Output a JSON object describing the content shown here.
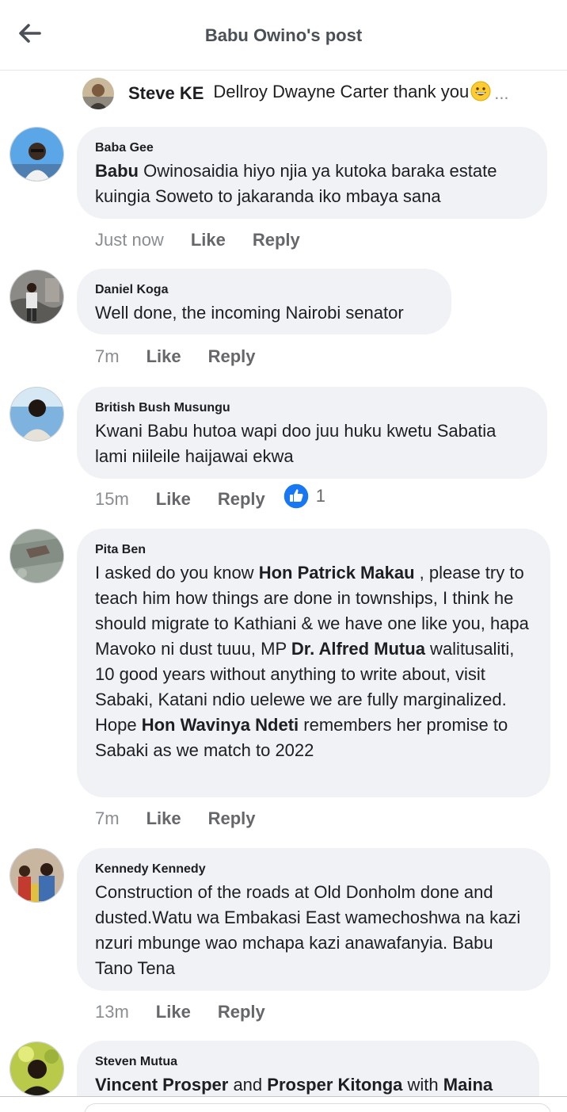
{
  "header": {
    "title": "Babu Owino's post",
    "back_icon": "arrow-left-icon"
  },
  "reply_preview": {
    "author": "Steve KE",
    "text": "Dellroy Dwayne Carter thank you",
    "emoji": "grinning-face-emoji",
    "more": "..."
  },
  "comments": [
    {
      "author": "Baba Gee",
      "body": [
        {
          "b": "Babu"
        },
        {
          "t": " Owinosaidia hiyo njia ya kutoka baraka estate kuingia Soweto to jakaranda iko mbaya sana"
        }
      ],
      "time": "Just now",
      "like": "Like",
      "reply": "Reply"
    },
    {
      "author": "Daniel Koga",
      "body": [
        {
          "t": "Well done, the incoming Nairobi senator"
        }
      ],
      "time": "7m",
      "like": "Like",
      "reply": "Reply"
    },
    {
      "author": "British Bush Musungu",
      "body": [
        {
          "t": "Kwani Babu hutoa wapi doo juu huku kwetu Sabatia lami niileile haijawai ekwa"
        }
      ],
      "time": "15m",
      "like": "Like",
      "reply": "Reply",
      "reaction_count": "1"
    },
    {
      "author": "Pita Ben",
      "body": [
        {
          "t": "I asked do you know "
        },
        {
          "b": "Hon Patrick Makau"
        },
        {
          "t": " , please try to teach him how things are done in townships, I think he should migrate to Kathiani & we have one like you, hapa Mavoko ni dust tuuu, MP "
        },
        {
          "b": "Dr. Alfred Mutua"
        },
        {
          "t": " walitusaliti, 10 good years without anything to write about, visit Sabaki, Katani ndio uelewe we are fully marginalized. Hope "
        },
        {
          "b": "Hon Wavinya Ndeti"
        },
        {
          "t": " remembers her promise to Sabaki as we match to 2022"
        }
      ],
      "time": "7m",
      "like": "Like",
      "reply": "Reply"
    },
    {
      "author": "Kennedy Kennedy",
      "body": [
        {
          "t": "Construction of the roads at Old Donholm done and dusted.Watu wa Embakasi East wamechoshwa na kazi nzuri mbunge wao mchapa kazi anawafanyia. Babu Tano Tena"
        }
      ],
      "time": "13m",
      "like": "Like",
      "reply": "Reply"
    },
    {
      "author": "Steven Mutua",
      "body": [
        {
          "b": "Vincent Prosper"
        },
        {
          "t": " and "
        },
        {
          "b": "Prosper Kitonga"
        },
        {
          "t": " with "
        },
        {
          "b": "Maina"
        }
      ]
    }
  ],
  "colors": {
    "bubble": "#f0f2f5",
    "like_blue": "#1877f2",
    "meta_text": "#65676b"
  }
}
